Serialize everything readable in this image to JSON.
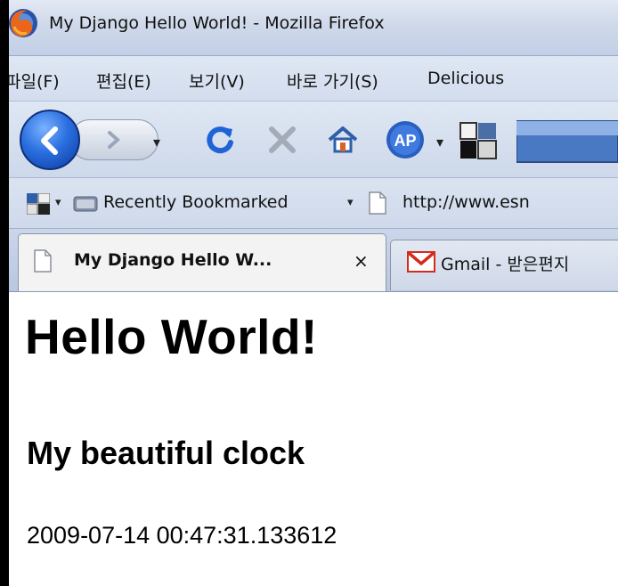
{
  "window": {
    "title": "My Django Hello World! - Mozilla Firefox"
  },
  "menu": {
    "items": [
      "파일(F)",
      "편집(E)",
      "보기(V)",
      "바로 가기(S)",
      "Delicious"
    ]
  },
  "bookmarks_bar": {
    "recently_bookmarked": "Recently Bookmarked",
    "url_item": "http://www.esn"
  },
  "tabs": [
    {
      "label": "My Django Hello W...",
      "close": "×",
      "active": true
    },
    {
      "label": "Gmail - 받은편지",
      "active": false
    }
  ],
  "page": {
    "heading": "Hello World!",
    "subheading": "My beautiful clock",
    "clock_value": "2009-07-14 00:47:31.133612"
  },
  "colors": {
    "chrome_light": "#dfe7f3",
    "chrome_dark": "#c2cfe6",
    "back_button": "#2b6fe0",
    "reload": "#1f63d6",
    "stop": "#9aa3b2",
    "gmail_red": "#d52a1e"
  },
  "icons": [
    "firefox-icon",
    "back-icon",
    "forward-icon",
    "reload-icon",
    "stop-icon",
    "home-icon",
    "addon-icon",
    "screen-icon",
    "bookmark-icon",
    "page-icon",
    "gmail-icon"
  ]
}
